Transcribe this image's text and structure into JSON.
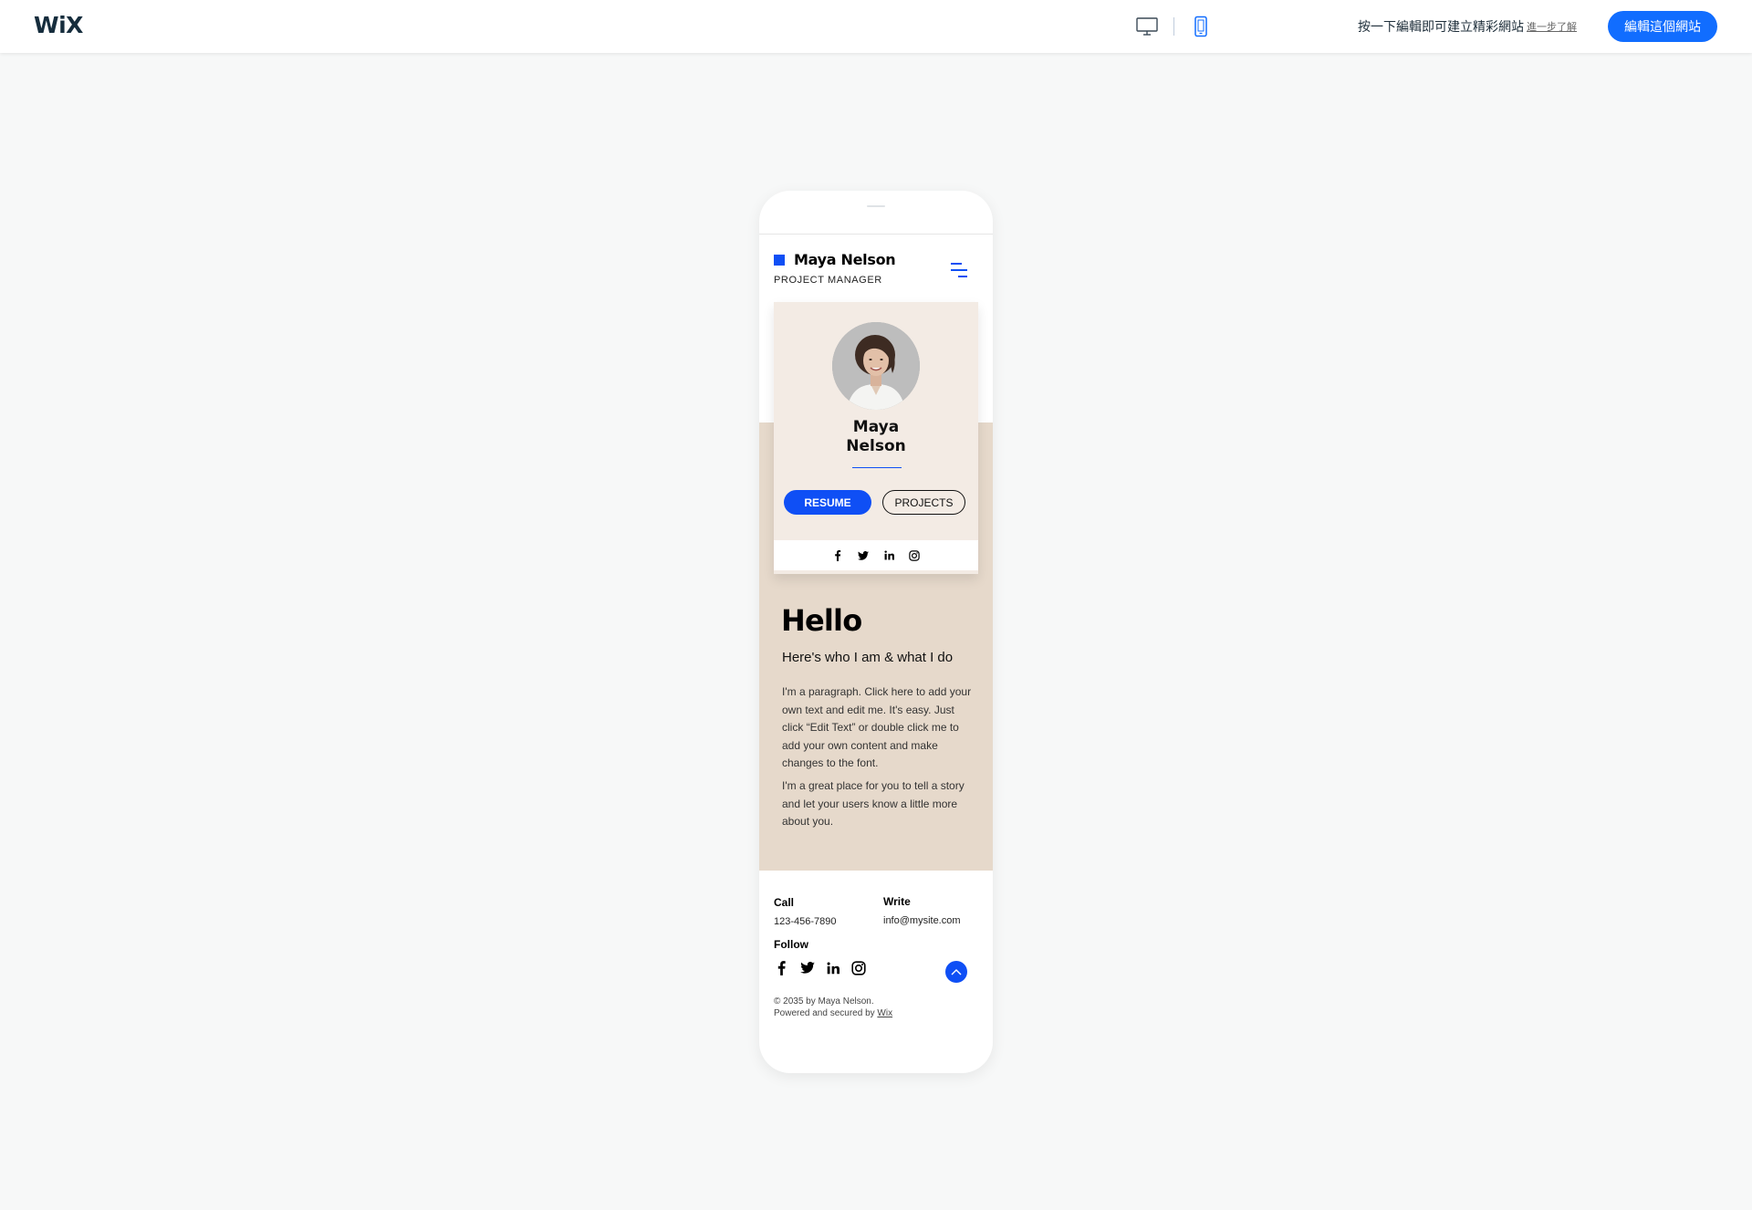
{
  "topbar": {
    "logo": "WiX",
    "device_desktop_icon": "desktop-monitor-icon",
    "device_mobile_icon": "mobile-phone-icon",
    "promo_text": "按一下編輯即可建立精彩網站",
    "learn_more": "進一步了解",
    "edit_button": "編輯這個網站",
    "colors": {
      "accent": "#116dff",
      "active_device": "#116dff"
    }
  },
  "site": {
    "header": {
      "name": "Maya Nelson",
      "role": "PROJECT MANAGER",
      "menu_icon": "hamburger-menu-icon",
      "brand_color": "#0f4ff5"
    },
    "profile": {
      "avatar_icon": "portrait-photo",
      "name_line1": "Maya",
      "name_line2": "Nelson",
      "resume_label": "RESUME",
      "projects_label": "PROJECTS",
      "social": [
        "facebook-icon",
        "twitter-icon",
        "linkedin-icon",
        "instagram-icon"
      ]
    },
    "about": {
      "title": "Hello",
      "subtitle": "Here's who I am & what I do",
      "paragraph1": "I'm a paragraph. Click here to add your own text and edit me. It's easy. Just click “Edit Text” or double click me to add your own content and make changes to the font.",
      "paragraph2": "I'm a great place for you to tell a story and let your users know a little more about you."
    },
    "footer": {
      "call_label": "Call",
      "call_value": "123-456-7890",
      "write_label": "Write",
      "write_value": "info@mysite.com",
      "follow_label": "Follow",
      "social": [
        "facebook-icon",
        "twitter-icon",
        "linkedin-icon",
        "instagram-icon"
      ],
      "back_to_top_icon": "chevron-up-icon",
      "copyright_line1": "© 2035 by Maya Nelson.",
      "copyright_line2_prefix": "Powered and secured by ",
      "copyright_link": "Wix"
    },
    "colors": {
      "beige": "#e6d9cb",
      "card": "#f3ebe4",
      "blue": "#0f4ff5"
    }
  }
}
